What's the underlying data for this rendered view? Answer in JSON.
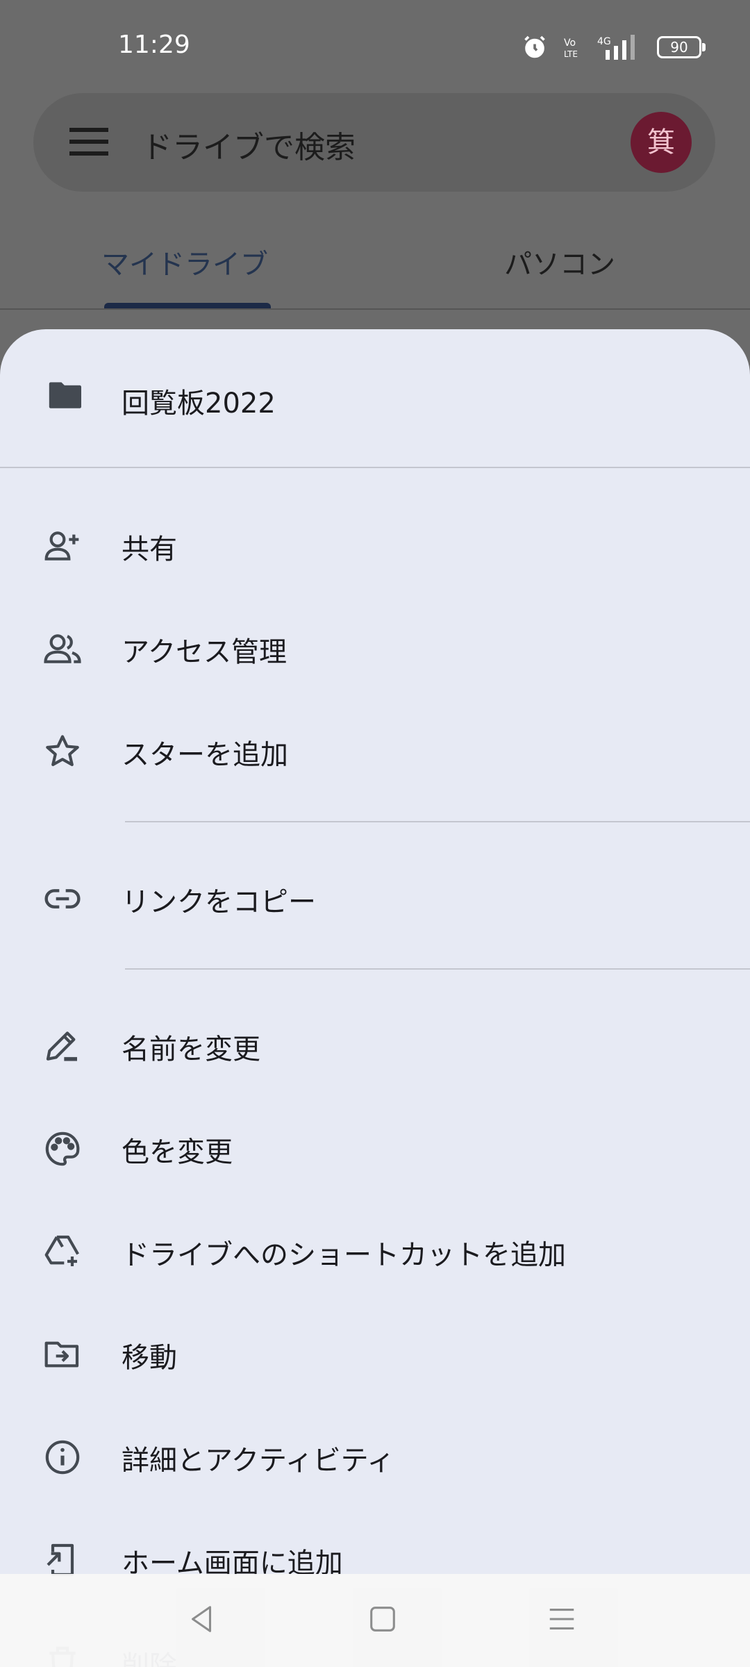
{
  "status_bar": {
    "time": "11:29",
    "battery": "90",
    "icons": [
      "alarm-icon",
      "volte-icon",
      "signal-4g-icon",
      "battery-icon"
    ]
  },
  "search": {
    "placeholder": "ドライブで検索",
    "avatar_initial": "箕"
  },
  "tabs": [
    {
      "label": "マイドライブ",
      "selected": true
    },
    {
      "label": "パソコン",
      "selected": false
    }
  ],
  "sheet": {
    "title": "回覧板2022",
    "items": [
      {
        "label": "共有",
        "icon": "person-add-icon"
      },
      {
        "label": "アクセス管理",
        "icon": "people-icon"
      },
      {
        "label": "スターを追加",
        "icon": "star-icon"
      },
      {
        "label": "リンクをコピー",
        "icon": "link-icon"
      },
      {
        "label": "名前を変更",
        "icon": "edit-icon"
      },
      {
        "label": "色を変更",
        "icon": "palette-icon"
      },
      {
        "label": "ドライブへのショートカットを追加",
        "icon": "drive-shortcut-icon"
      },
      {
        "label": "移動",
        "icon": "move-folder-icon"
      },
      {
        "label": "詳細とアクティビティ",
        "icon": "info-icon"
      },
      {
        "label": "ホーム画面に追加",
        "icon": "add-to-home-icon"
      },
      {
        "label": "削除",
        "icon": "trash-icon"
      }
    ]
  },
  "colors": {
    "sheet_bg": "#e7eaf4",
    "scrim": "#6b6b6b",
    "avatar_bg": "#6b1a31",
    "tab_indicator": "#1c2a47"
  },
  "nav": [
    "back-icon",
    "home-icon",
    "recents-icon"
  ]
}
